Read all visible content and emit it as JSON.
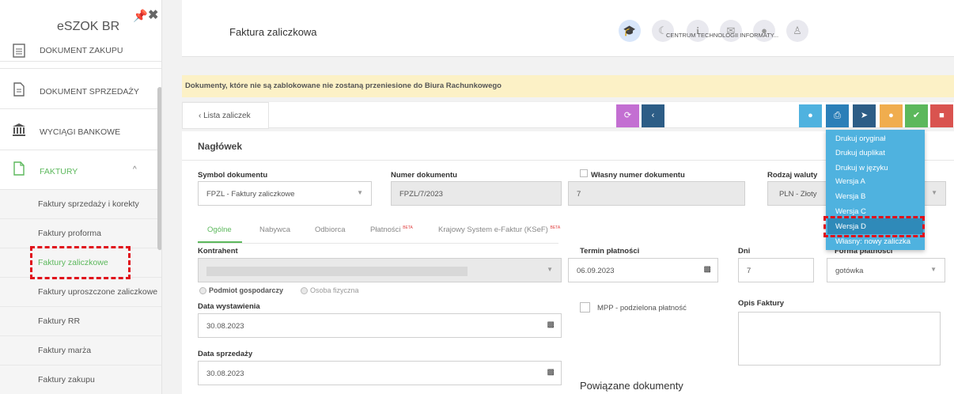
{
  "sidebar": {
    "brand": "eSZOK BR",
    "items": [
      {
        "label": "DOKUMENT ZAKUPU"
      },
      {
        "label": "DOKUMENT SPRZEDAŻY"
      },
      {
        "label": "WYCIĄGI BANKOWE"
      },
      {
        "label": "FAKTURY"
      }
    ],
    "sub_items": [
      {
        "label": "Faktury sprzedaży i korekty"
      },
      {
        "label": "Faktury proforma"
      },
      {
        "label": "Faktury zaliczkowe"
      },
      {
        "label": "Faktury uproszczone zaliczkowe"
      },
      {
        "label": "Faktury RR"
      },
      {
        "label": "Faktury marża"
      },
      {
        "label": "Faktury zakupu"
      }
    ]
  },
  "header": {
    "title": "Faktura zaliczkowa",
    "company": "CENTRUM TECHNOLOGII INFORMATY..."
  },
  "warning": "Dokumenty, które nie są zablokowane nie zostaną przeniesione do Biura Rachunkowego",
  "toolbar": {
    "back_label": "‹  Lista zaliczek"
  },
  "section": {
    "title": "Nagłówek"
  },
  "form": {
    "symbol_label": "Symbol dokumentu",
    "symbol_value": "FPZL - Faktury zaliczkowe",
    "numer_label": "Numer dokumentu",
    "numer_value": "FPZL/7/2023",
    "wlasny_label": "Własny numer dokumentu",
    "wlasny_value": "7",
    "waluta_label": "Rodzaj waluty",
    "waluta_value": "PLN - Złoty",
    "tabs": [
      {
        "label": "Ogólne"
      },
      {
        "label": "Nabywca"
      },
      {
        "label": "Odbiorca"
      },
      {
        "label": "Płatności",
        "badge": "BETA"
      },
      {
        "label": "Krajowy System e-Faktur (KSeF)",
        "badge": "BETA"
      }
    ],
    "kontrahent_label": "Kontrahent",
    "radio_1": "Podmiot gospodarczy",
    "radio_2": "Osoba fizyczna",
    "data_wyst_label": "Data wystawienia",
    "data_wyst_value": "30.08.2023",
    "data_sprz_label": "Data sprzedaży",
    "data_sprz_value": "30.08.2023",
    "termin_label": "Termin płatności",
    "termin_value": "06.09.2023",
    "dni_label": "Dni",
    "dni_value": "7",
    "forma_label": "Forma płatności",
    "forma_value": "gotówka",
    "mpp_label": "MPP - podzielona płatność",
    "opis_label": "Opis Faktury",
    "powiazane_label": "Powiązane dokumenty"
  },
  "print_menu": {
    "items": [
      {
        "label": "Drukuj oryginał"
      },
      {
        "label": "Drukuj duplikat"
      },
      {
        "label": "Drukuj w języku"
      },
      {
        "label": "Wersja A"
      },
      {
        "label": "Wersja B"
      },
      {
        "label": "Wersja C"
      },
      {
        "label": "Wersja D"
      },
      {
        "label": "Własny: nowy zaliczka"
      }
    ],
    "highlighted": "Wersja D"
  },
  "colors": {
    "accent_green": "#5cb85c",
    "menu_blue": "#4fb2df",
    "highlight_red": "#e0101a",
    "warning_bg": "#fcf1c6"
  }
}
